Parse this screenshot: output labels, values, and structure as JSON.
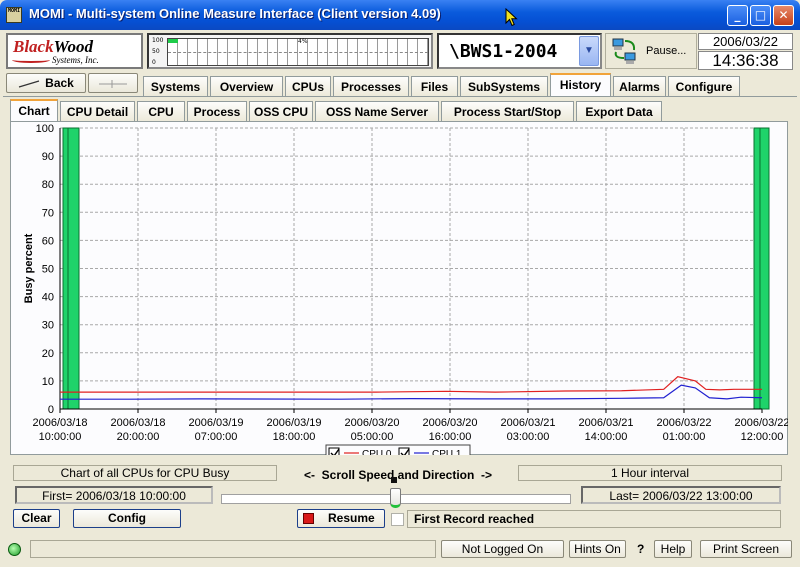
{
  "window": {
    "title": "MOMI - Multi-system Online Measure Interface (Client version 4.09)",
    "icon_text": "MOMI",
    "minimize_icon": "minimize-icon",
    "maximize_icon": "maximize-icon",
    "close_icon": "close-icon"
  },
  "header": {
    "logo_line1_a": "Black",
    "logo_line1_b": "Wood",
    "logo_line2": "Systems, Inc.",
    "meter": {
      "labels": [
        "100",
        "50",
        "0"
      ],
      "percent_text": "4%",
      "level": 0.04
    },
    "system_name": "\\BWS1-2004",
    "pause_label": "Pause...",
    "date": "2006/03/22",
    "time": "14:36:38"
  },
  "nav": {
    "back_label": "Back",
    "tabs": [
      "Systems",
      "Overview",
      "CPUs",
      "Processes",
      "Files",
      "SubSystems",
      "History",
      "Alarms",
      "Configure"
    ],
    "active_tab": "History"
  },
  "subtabs": {
    "items": [
      "Chart",
      "CPU Detail",
      "CPU",
      "Process",
      "OSS CPU",
      "OSS Name Server",
      "Process Start/Stop",
      "Export Data"
    ],
    "active": "Chart"
  },
  "chart_data": {
    "type": "line",
    "ylabel": "Busy percent",
    "xlabel": "",
    "ylim": [
      0,
      100
    ],
    "yticks": [
      0,
      10,
      20,
      30,
      40,
      50,
      60,
      70,
      80,
      90,
      100
    ],
    "grid": true,
    "xtick_labels": [
      [
        "2006/03/18",
        "10:00:00"
      ],
      [
        "2006/03/18",
        "20:00:00"
      ],
      [
        "2006/03/19",
        "07:00:00"
      ],
      [
        "2006/03/19",
        "18:00:00"
      ],
      [
        "2006/03/20",
        "05:00:00"
      ],
      [
        "2006/03/20",
        "16:00:00"
      ],
      [
        "2006/03/21",
        "03:00:00"
      ],
      [
        "2006/03/21",
        "14:00:00"
      ],
      [
        "2006/03/22",
        "01:00:00"
      ],
      [
        "2006/03/22",
        "12:00:00"
      ]
    ],
    "legend_placement": "bottom-center",
    "series": [
      {
        "name": "CPU 0",
        "color": "#e02020",
        "points": [
          [
            0,
            6
          ],
          [
            0.15,
            6
          ],
          [
            0.3,
            6
          ],
          [
            0.45,
            6
          ],
          [
            0.55,
            6.3
          ],
          [
            0.62,
            6
          ],
          [
            0.72,
            6.4
          ],
          [
            0.8,
            6.5
          ],
          [
            0.86,
            7
          ],
          [
            0.88,
            11.5
          ],
          [
            0.905,
            10
          ],
          [
            0.92,
            7
          ],
          [
            0.94,
            6.8
          ],
          [
            0.96,
            7
          ],
          [
            1.0,
            7
          ]
        ]
      },
      {
        "name": "CPU 1",
        "color": "#2020d0",
        "points": [
          [
            0,
            3.5
          ],
          [
            0.1,
            3.5
          ],
          [
            0.2,
            3.6
          ],
          [
            0.4,
            3.5
          ],
          [
            0.5,
            3.7
          ],
          [
            0.6,
            3.6
          ],
          [
            0.7,
            3.6
          ],
          [
            0.8,
            3.8
          ],
          [
            0.86,
            4
          ],
          [
            0.885,
            8.5
          ],
          [
            0.905,
            7.5
          ],
          [
            0.925,
            4
          ],
          [
            0.95,
            3.6
          ],
          [
            0.97,
            4.2
          ],
          [
            1.0,
            4
          ]
        ]
      }
    ]
  },
  "controls": {
    "chart_desc": "Chart of all CPUs for CPU Busy",
    "scroll_label": "<-  Scroll Speed and Direction  ->",
    "interval": "1 Hour interval",
    "first_record": "First= 2006/03/18 10:00:00",
    "last_record": "Last= 2006/03/22 13:00:00",
    "clear_label": "Clear",
    "config_label": "Config",
    "resume_label": "Resume",
    "status_message": "First Record reached",
    "scroll_position": 0.5
  },
  "statusbar": {
    "login_label": "Not Logged On",
    "hints_label": "Hints On",
    "question_label": "?",
    "help_label": "Help",
    "print_label": "Print Screen"
  }
}
